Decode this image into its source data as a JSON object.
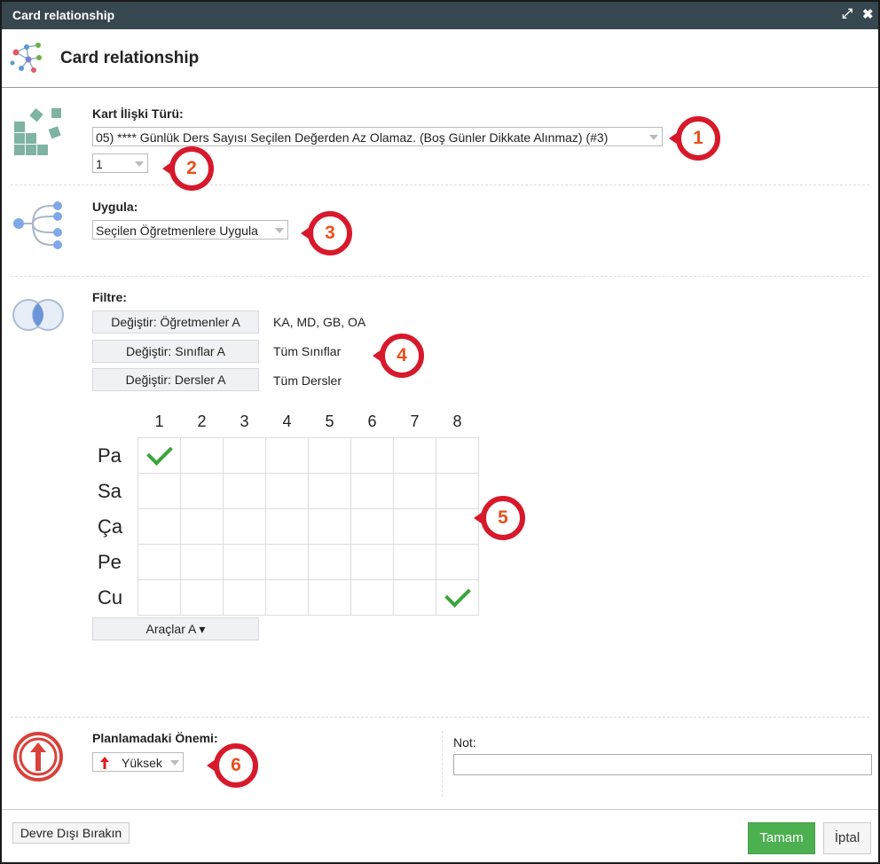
{
  "window": {
    "title": "Card relationship",
    "expand_glyph": "⤢",
    "close_glyph": "✖"
  },
  "header": {
    "title": "Card relationship",
    "icon": "network-graph-icon"
  },
  "relation_type": {
    "label": "Kart İlişki Türü:",
    "value": "05) **** Günlük Ders Sayısı Seçilen Değerden Az Olamaz. (Boş Günler Dikkate Alınmaz) (#3)",
    "count_value": "1"
  },
  "apply": {
    "label": "Uygula:",
    "value": "Seçilen Öğretmenlere Uygula"
  },
  "filter": {
    "label": "Filtre:",
    "rows": [
      {
        "button": "Değiştir: Öğretmenler A",
        "value": "KA, MD, GB, OA"
      },
      {
        "button": "Değiştir: Sınıflar A",
        "value": "Tüm Sınıflar"
      },
      {
        "button": "Değiştir: Dersler A",
        "value": "Tüm Dersler"
      }
    ]
  },
  "grid": {
    "periods": [
      "1",
      "2",
      "3",
      "4",
      "5",
      "6",
      "7",
      "8"
    ],
    "days": [
      "Pa",
      "Sa",
      "Ça",
      "Pe",
      "Cu"
    ],
    "checked": [
      [
        0,
        0
      ],
      [
        4,
        7
      ]
    ]
  },
  "tools_button": "Araçlar A ▾",
  "importance": {
    "label": "Planlamadaki Önemi:",
    "value": "Yüksek",
    "icon": "arrow-up-icon"
  },
  "note": {
    "label": "Not:",
    "value": ""
  },
  "footer": {
    "disable": "Devre Dışı Bırakın",
    "ok": "Tamam",
    "cancel": "İptal"
  },
  "callouts": [
    "1",
    "2",
    "3",
    "4",
    "5",
    "6"
  ],
  "colors": {
    "titlebar": "#37474f",
    "accent_red": "#d7192b",
    "callout_number": "#e8501d",
    "ok_green": "#4caf50",
    "check_green": "#3aa53a"
  }
}
